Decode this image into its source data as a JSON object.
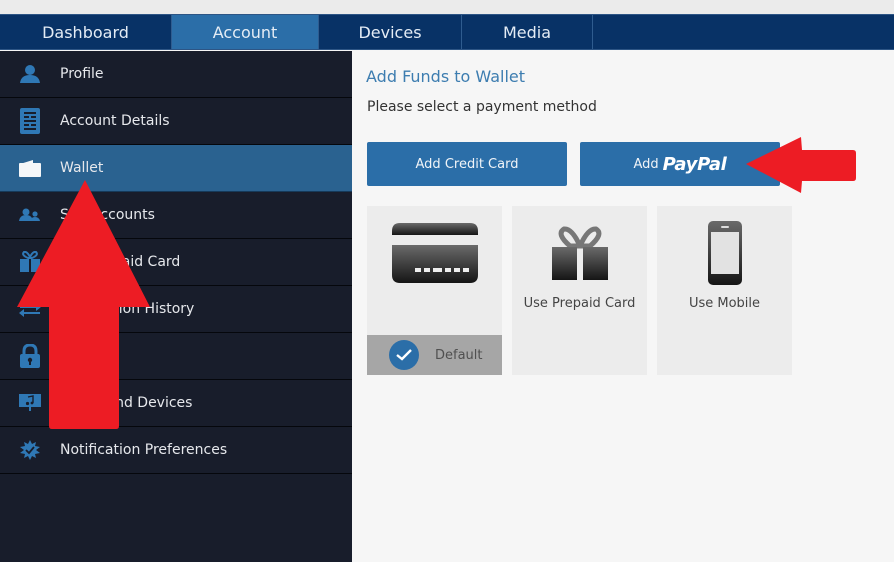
{
  "topnav": {
    "tabs": [
      {
        "label": "Dashboard",
        "active": false
      },
      {
        "label": "Account",
        "active": true
      },
      {
        "label": "Devices",
        "active": false
      },
      {
        "label": "Media",
        "active": false
      }
    ]
  },
  "sidebar": {
    "items": [
      {
        "label": "Profile",
        "icon": "user-icon",
        "active": false
      },
      {
        "label": "Account Details",
        "icon": "document-icon",
        "active": false
      },
      {
        "label": "Wallet",
        "icon": "wallet-icon",
        "active": true
      },
      {
        "label": "Sub Accounts",
        "icon": "users-icon",
        "active": false
      },
      {
        "label": "Use Prepaid Card",
        "icon": "gift-icon",
        "active": false
      },
      {
        "label": "Transaction History",
        "icon": "transfer-arrows-icon",
        "active": false
      },
      {
        "label": "Security",
        "icon": "lock-icon",
        "active": false
      },
      {
        "label": "Media and Devices",
        "icon": "music-monitor-icon",
        "active": false
      },
      {
        "label": "Notification Preferences",
        "icon": "badge-check-icon",
        "active": false
      }
    ]
  },
  "main": {
    "title": "Add Funds to Wallet",
    "subtitle": "Please select a payment method",
    "buttons": {
      "add_credit_card": "Add Credit Card",
      "add_paypal_prefix": "Add",
      "add_paypal_brand": "PayPal"
    },
    "methods": [
      {
        "label": "",
        "icon": "credit-card-icon",
        "default_label": "Default",
        "is_default": true
      },
      {
        "label": "Use Prepaid Card",
        "icon": "gift-icon"
      },
      {
        "label": "Use Mobile",
        "icon": "mobile-phone-icon"
      }
    ]
  },
  "annotations": {
    "arrows": [
      {
        "direction": "up",
        "points_to": "Wallet",
        "color": "#ed1c24"
      },
      {
        "direction": "left",
        "points_to": "Add PayPal",
        "color": "#ed1c24"
      }
    ]
  },
  "colors": {
    "nav_bg": "#083266",
    "nav_active": "#2b6ea8",
    "sidebar_bg": "#181d2b",
    "sidebar_active": "#2a6290",
    "accent": "#2b6ea8",
    "title": "#3d7db0",
    "arrow": "#ed1c24"
  }
}
